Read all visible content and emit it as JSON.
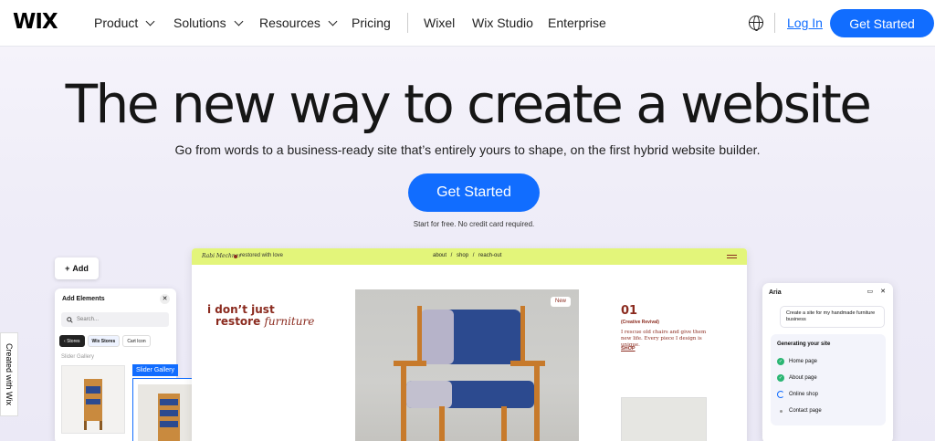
{
  "nav": {
    "logo": "WIX",
    "items": [
      {
        "label": "Product",
        "dropdown": true
      },
      {
        "label": "Solutions",
        "dropdown": true
      },
      {
        "label": "Resources",
        "dropdown": true
      },
      {
        "label": "Pricing",
        "dropdown": false
      },
      {
        "label": "Wixel",
        "dropdown": false
      },
      {
        "label": "Wix Studio",
        "dropdown": false
      },
      {
        "label": "Enterprise",
        "dropdown": false
      }
    ],
    "login": "Log In",
    "cta": "Get Started"
  },
  "hero": {
    "title": "The new way to create a website",
    "subtitle": "Go from words to a business-ready site that’s entirely yours to shape, on the first hybrid website builder.",
    "cta": "Get Started",
    "note": "Start for free. No credit card required."
  },
  "badge": {
    "created_with": "Created with Wix"
  },
  "editor": {
    "add_button": "Add",
    "add_panel": {
      "title": "Add Elements",
      "search_placeholder": "Search...",
      "chips": [
        "Stores",
        "Wix Stores",
        "Cart Icon"
      ],
      "section_label": "Slider Gallery"
    },
    "gallery_tag": "Slider Gallery"
  },
  "site_preview": {
    "brand": "Rabi Mechner",
    "tagline": "restored with love",
    "menu": "about / shop / reach-out",
    "headline_line1": "i don’t just",
    "headline_line2_bold": "restore",
    "headline_line2_italic": "furniture",
    "new_badge": "New",
    "number": "01",
    "subheading": "(Creative Revival)",
    "description": "I rescue old chairs and give them new life. Every piece I design is unique.",
    "shop_link": "SHOP"
  },
  "aria": {
    "title": "Aria",
    "prompt": "Create a site for my handmade furniture business",
    "status_title": "Generating your site",
    "steps": [
      {
        "label": "Home page",
        "state": "done"
      },
      {
        "label": "About page",
        "state": "done"
      },
      {
        "label": "Online shop",
        "state": "loading"
      },
      {
        "label": "Contact page",
        "state": "pending"
      }
    ]
  },
  "colors": {
    "accent": "#116dff",
    "site_bar": "#e3f57a",
    "site_text": "#8b2b1f",
    "chair_seat": "#2c4a8f",
    "chair_wood": "#c77a2b"
  }
}
